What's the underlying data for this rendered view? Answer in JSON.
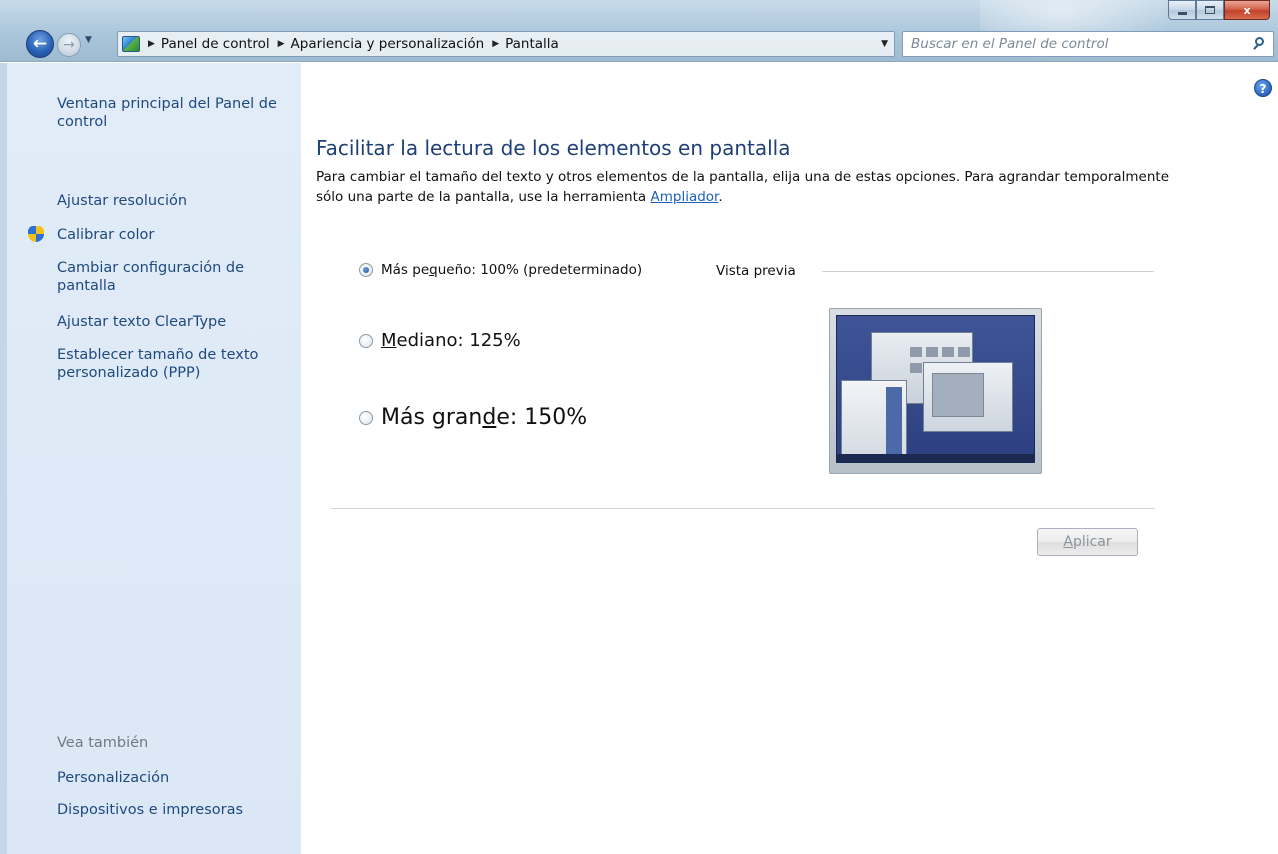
{
  "window": {
    "close_glyph": "x",
    "help_glyph": "?"
  },
  "address_bar": {
    "breadcrumbs": [
      "Panel de control",
      "Apariencia y personalización",
      "Pantalla"
    ]
  },
  "search": {
    "placeholder": "Buscar en el Panel de control"
  },
  "sidebar": {
    "items": [
      {
        "label": "Ventana principal del Panel de control"
      },
      {
        "label": "Ajustar resolución"
      },
      {
        "label": "Calibrar color"
      },
      {
        "label": "Cambiar configuración de pantalla"
      },
      {
        "label": "Ajustar texto ClearType"
      },
      {
        "label": "Establecer tamaño de texto personalizado (PPP)"
      }
    ],
    "see_also_label": "Vea también",
    "see_also": [
      {
        "label": "Personalización"
      },
      {
        "label": "Dispositivos e impresoras"
      }
    ]
  },
  "main": {
    "title": "Facilitar la lectura de los elementos en pantalla",
    "description_before": "Para cambiar el tamaño del texto y otros elementos de la pantalla, elija una de estas opciones. Para agrandar temporalmente sólo una parte de la pantalla, use la herramienta ",
    "description_link": "Ampliador",
    "description_after": ".",
    "options": [
      {
        "pre": "Más pe",
        "key": "q",
        "post": "ueño: 100% (predeterminado)",
        "selected": true
      },
      {
        "pre": "",
        "key": "M",
        "post": "ediano: 125%",
        "selected": false
      },
      {
        "pre": "Más gran",
        "key": "d",
        "post": "e: 150%",
        "selected": false
      }
    ],
    "preview_label": "Vista previa",
    "apply_key": "A",
    "apply_rest": "plicar"
  },
  "colors": {
    "link": "#1f4a7f",
    "title": "#1e3f77",
    "sidebar_bg": "#dbe7f6"
  },
  "icons": [
    "back-arrow-icon",
    "forward-arrow-icon",
    "control-panel-icon",
    "refresh-icon",
    "search-icon",
    "help-icon",
    "shield-icon"
  ]
}
